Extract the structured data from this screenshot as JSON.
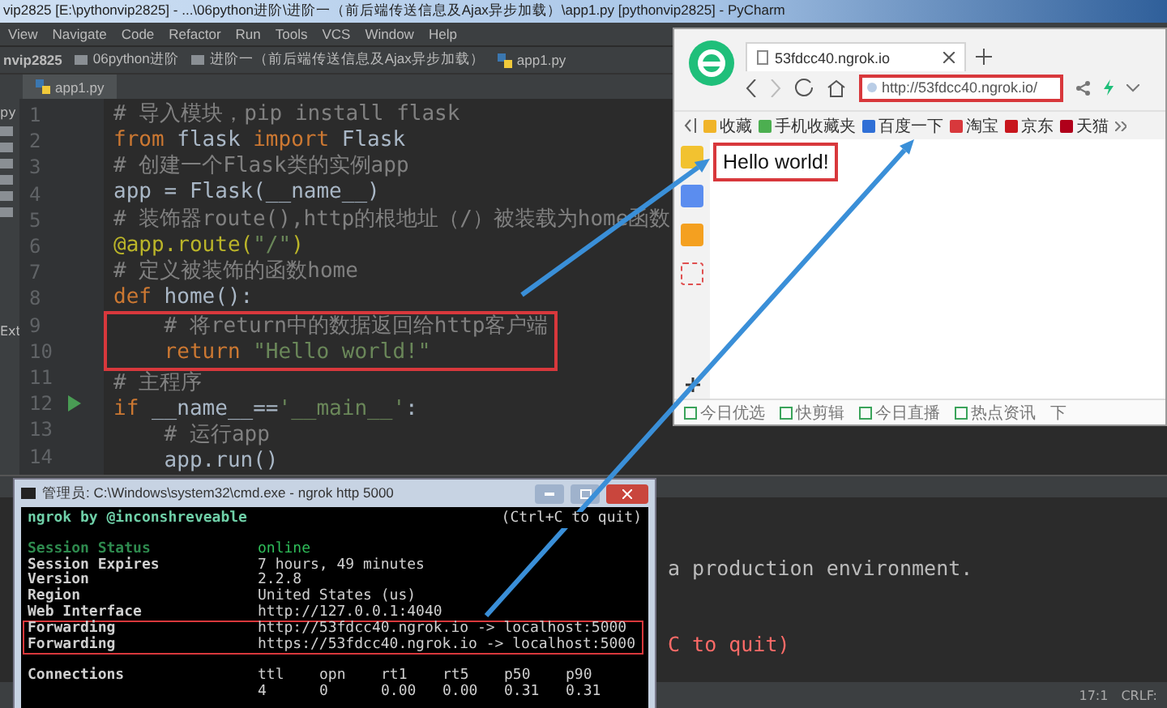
{
  "ide": {
    "title": "vip2825 [E:\\pythonvip2825] - ...\\06python进阶\\进阶一（前后端传送信息及Ajax异步加载）\\app1.py [pythonvip2825] - PyCharm",
    "menu": [
      "View",
      "Navigate",
      "Code",
      "Refactor",
      "Run",
      "Tools",
      "VCS",
      "Window",
      "Help"
    ],
    "breadcrumbs": [
      {
        "kind": "project",
        "label": "nvip2825"
      },
      {
        "kind": "folder",
        "label": "06python进阶"
      },
      {
        "kind": "folder",
        "label": "进阶一（前后端传送信息及Ajax异步加载）"
      },
      {
        "kind": "file",
        "label": "app1.py"
      }
    ],
    "tabs": [
      {
        "label": "app1.py",
        "selected": true
      }
    ],
    "project_labels": [
      "py",
      "Ext"
    ],
    "code": [
      {
        "number": "1",
        "boxed": false,
        "run_marker": false,
        "tokens": [
          {
            "kind": "comment",
            "text": "# 导入模块，pip install flask"
          }
        ]
      },
      {
        "number": "2",
        "boxed": false,
        "run_marker": false,
        "tokens": [
          {
            "kind": "keyword",
            "text": "from"
          },
          {
            "kind": "plain",
            "text": " flask "
          },
          {
            "kind": "keyword",
            "text": "import"
          },
          {
            "kind": "plain",
            "text": " Flask"
          }
        ]
      },
      {
        "number": "3",
        "boxed": false,
        "run_marker": false,
        "tokens": [
          {
            "kind": "comment",
            "text": "# 创建一个Flask类的实例app"
          }
        ]
      },
      {
        "number": "4",
        "boxed": false,
        "run_marker": false,
        "tokens": [
          {
            "kind": "plain",
            "text": "app = Flask(__name__)"
          }
        ]
      },
      {
        "number": "5",
        "boxed": false,
        "run_marker": false,
        "tokens": [
          {
            "kind": "comment",
            "text": "# 装饰器route(),http的根地址（/）被装载为home函数"
          }
        ]
      },
      {
        "number": "6",
        "boxed": false,
        "run_marker": false,
        "tokens": [
          {
            "kind": "decorator",
            "text": "@app.route("
          },
          {
            "kind": "string",
            "text": "\"/\""
          },
          {
            "kind": "decorator",
            "text": ")"
          }
        ]
      },
      {
        "number": "7",
        "boxed": false,
        "run_marker": false,
        "tokens": [
          {
            "kind": "comment",
            "text": "# 定义被装饰的函数home"
          }
        ]
      },
      {
        "number": "8",
        "boxed": false,
        "run_marker": false,
        "tokens": [
          {
            "kind": "keyword",
            "text": "def"
          },
          {
            "kind": "plain",
            "text": " home():"
          }
        ]
      },
      {
        "number": "9",
        "boxed": true,
        "run_marker": false,
        "tokens": [
          {
            "kind": "comment",
            "text": "    # 将return中的数据返回给http客户端"
          }
        ]
      },
      {
        "number": "10",
        "boxed": true,
        "run_marker": false,
        "tokens": [
          {
            "kind": "keyword",
            "text": "    return"
          },
          {
            "kind": "string",
            "text": " \"Hello world!\""
          }
        ]
      },
      {
        "number": "11",
        "boxed": false,
        "run_marker": false,
        "tokens": [
          {
            "kind": "comment",
            "text": "# 主程序"
          }
        ]
      },
      {
        "number": "12",
        "boxed": false,
        "run_marker": true,
        "tokens": [
          {
            "kind": "keyword",
            "text": "if"
          },
          {
            "kind": "plain",
            "text": " __name__=="
          },
          {
            "kind": "string",
            "text": "'__main__'"
          },
          {
            "kind": "plain",
            "text": ":"
          }
        ]
      },
      {
        "number": "13",
        "boxed": false,
        "run_marker": false,
        "tokens": [
          {
            "kind": "comment",
            "text": "    # 运行app"
          }
        ]
      },
      {
        "number": "14",
        "boxed": false,
        "run_marker": false,
        "tokens": [
          {
            "kind": "plain",
            "text": "    app.run()"
          }
        ]
      }
    ],
    "run_output": [
      {
        "kind": "info",
        "text": "a production environment."
      },
      {
        "kind": "error",
        "text": "C to quit)"
      }
    ],
    "status_bar": [
      "17:1",
      "CRLF:"
    ]
  },
  "browser": {
    "tab": {
      "label": "53fdcc40.ngrok.io",
      "selected": true
    },
    "url": "http://53fdcc40.ngrok.io/",
    "bookmarks": [
      {
        "kind": "favorites",
        "label": "收藏"
      },
      {
        "kind": "phone",
        "label": "手机收藏夹"
      },
      {
        "kind": "baidu",
        "label": "百度一下"
      },
      {
        "kind": "taobao",
        "label": "淘宝"
      },
      {
        "kind": "jd",
        "label": "京东"
      },
      {
        "kind": "tmall",
        "label": "天猫"
      }
    ],
    "page_text": "Hello world!",
    "bottom_bar": [
      {
        "kind": "picks",
        "label": "今日优选"
      },
      {
        "kind": "clip",
        "label": "快剪辑"
      },
      {
        "kind": "live",
        "label": "今日直播"
      },
      {
        "kind": "news",
        "label": "热点资讯"
      },
      {
        "kind": "download",
        "label": "下"
      }
    ]
  },
  "console": {
    "title": "管理员: C:\\Windows\\system32\\cmd.exe - ngrok  http 5000",
    "header": "ngrok by @inconshreveable",
    "hint": "(Ctrl+C to quit)",
    "rows": [
      {
        "kind": "status",
        "boxed": false,
        "label": "Session Status",
        "value": "online"
      },
      {
        "kind": "plain",
        "boxed": false,
        "label": "Session Expires",
        "value": "7 hours, 49 minutes"
      },
      {
        "kind": "plain",
        "boxed": false,
        "label": "Version",
        "value": "2.2.8"
      },
      {
        "kind": "plain",
        "boxed": false,
        "label": "Region",
        "value": "United States (us)"
      },
      {
        "kind": "plain",
        "boxed": false,
        "label": "Web Interface",
        "value": "http://127.0.0.1:4040"
      },
      {
        "kind": "plain",
        "boxed": true,
        "label": "Forwarding",
        "value": "http://53fdcc40.ngrok.io -> localhost:5000"
      },
      {
        "kind": "plain",
        "boxed": true,
        "label": "Forwarding",
        "value": "https://53fdcc40.ngrok.io -> localhost:5000"
      }
    ],
    "connections": {
      "label": "Connections",
      "columns": [
        "ttl",
        "opn",
        "rt1",
        "rt5",
        "p50",
        "p90"
      ],
      "values": [
        "4",
        "0",
        "0.00",
        "0.00",
        "0.31",
        "0.31"
      ]
    }
  }
}
